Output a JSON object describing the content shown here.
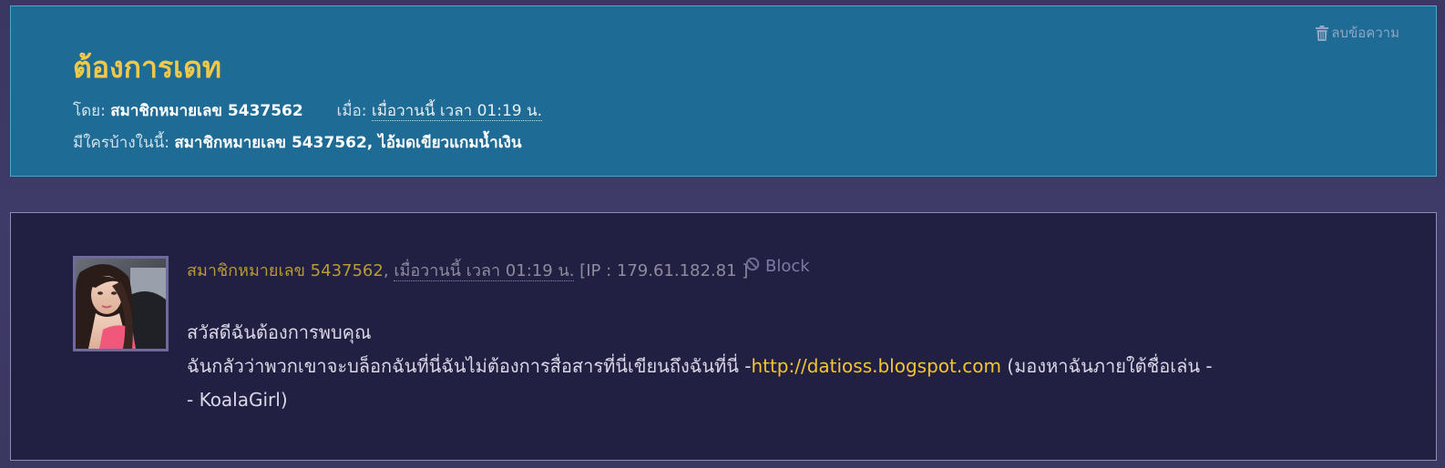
{
  "topic": {
    "title": "ต้องการเดท",
    "delete_label": "ลบข้อความ",
    "delete_icon": "trash-icon",
    "by_label": "โดย:",
    "author": "สมาชิกหมายเลข 5437562",
    "when_label": "เมื่อ:",
    "when_value": "เมื่อวานนี้ เวลา 01:19 น.",
    "participants_label": "มีใครบ้างในนี้:",
    "participants": "สมาชิกหมายเลข 5437562, ไอ้มดเขียวแกมน้ำเงิน"
  },
  "post": {
    "author": "สมาชิกหมายเลข 5437562",
    "separator": ",",
    "date": "เมื่อวานนี้ เวลา 01:19 น.",
    "ip": "[IP : 179.61.182.81 ]",
    "block_label": "Block",
    "block_icon": "block-icon",
    "body_line1": "สวัสดีฉันต้องการพบคุณ",
    "body_line2_prefix": "ฉันกลัวว่าพวกเขาจะบล็อกฉันที่นี่ฉันไม่ต้องการสื่อสารที่นี่เขียนถึงฉันที่นี่ -",
    "body_link": "http://datioss.blogspot.com",
    "body_line2_suffix": " (มองหาฉันภายใต้ชื่อเล่น -",
    "body_line3": "- KoalaGirl)"
  },
  "colors": {
    "page_bg": "#3a3760",
    "header_bg": "#1e6b96",
    "title": "#f2c84b",
    "post_bg": "#222042",
    "author_color": "#b99a34",
    "link_color": "#f3c531"
  }
}
